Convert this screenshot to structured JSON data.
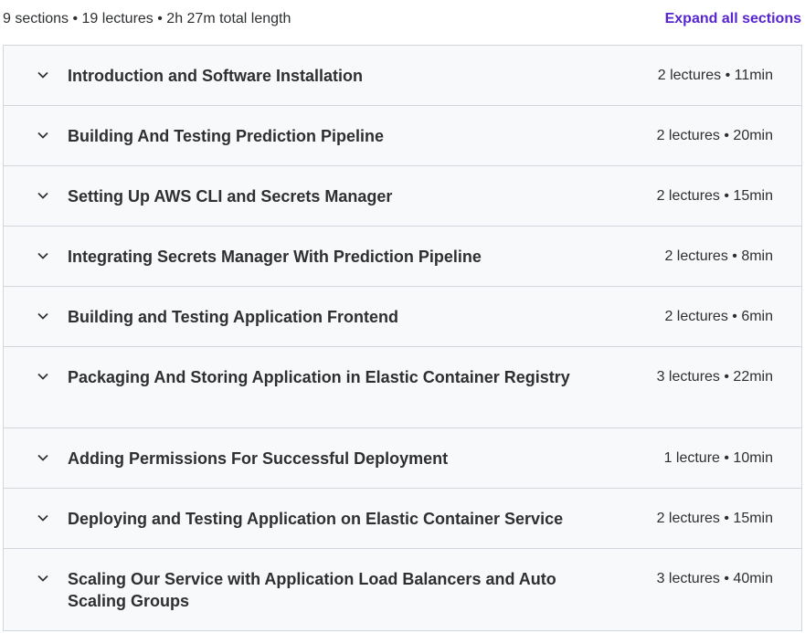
{
  "header": {
    "summary": "9 sections • 19 lectures • 2h 27m total length",
    "expand_label": "Expand all sections"
  },
  "colors": {
    "accent": "#5624d0",
    "section_bg": "#f7f9fa",
    "border": "#d1d7dc",
    "text": "#2d2f31"
  },
  "sections": [
    {
      "title": "Introduction and Software Installation",
      "meta": "2 lectures • 11min",
      "icon": "chevron-down-icon"
    },
    {
      "title": "Building And Testing Prediction Pipeline",
      "meta": "2 lectures • 20min",
      "icon": "chevron-down-icon"
    },
    {
      "title": "Setting Up AWS CLI and Secrets Manager",
      "meta": "2 lectures • 15min",
      "icon": "chevron-down-icon"
    },
    {
      "title": "Integrating Secrets Manager With Prediction Pipeline",
      "meta": "2 lectures • 8min",
      "icon": "chevron-down-icon"
    },
    {
      "title": "Building and Testing Application Frontend",
      "meta": "2 lectures • 6min",
      "icon": "chevron-down-icon"
    },
    {
      "title": "Packaging And Storing Application in Elastic Container Registry",
      "meta": "3 lectures • 22min",
      "icon": "chevron-down-icon"
    },
    {
      "title": "Adding Permissions For Successful Deployment",
      "meta": "1 lecture • 10min",
      "icon": "chevron-down-icon"
    },
    {
      "title": "Deploying and Testing Application on Elastic Container Service",
      "meta": "2 lectures • 15min",
      "icon": "chevron-down-icon"
    },
    {
      "title": "Scaling Our Service with Application Load Balancers and Auto Scaling Groups",
      "meta": "3 lectures • 40min",
      "icon": "chevron-down-icon"
    }
  ]
}
